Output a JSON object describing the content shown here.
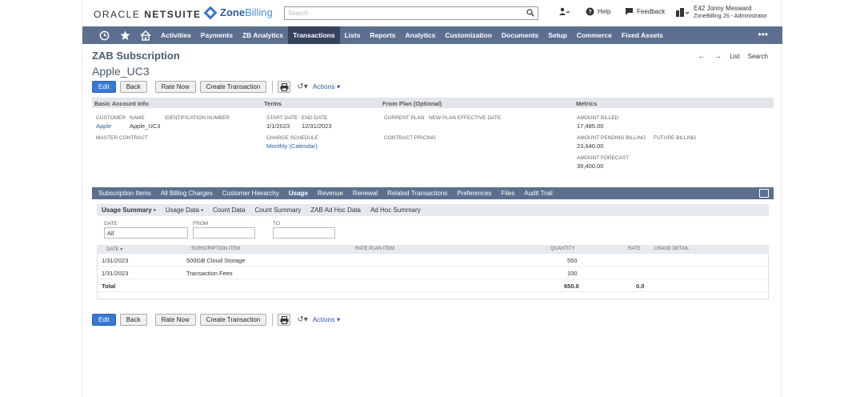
{
  "header": {
    "oracle_text": "ORACLE",
    "netsuite_text": "NETSUITE",
    "zb_bold": "Zone",
    "zb_light": "Billing",
    "search_placeholder": "Search",
    "help": "Help",
    "feedback": "Feedback",
    "user_name": "E42 Jonny Mesward",
    "user_role": "ZoneBilling JS - Administrator"
  },
  "nav": {
    "items": [
      "Activities",
      "Payments",
      "ZB Analytics",
      "Transactions",
      "Lists",
      "Reports",
      "Analytics",
      "Customization",
      "Documents",
      "Setup",
      "Commerce",
      "Fixed Assets"
    ],
    "active": "Transactions",
    "more": "•••"
  },
  "record": {
    "type": "ZAB Subscription",
    "name": "Apple_UC3",
    "list": "List",
    "search": "Search"
  },
  "buttons": {
    "edit": "Edit",
    "back": "Back",
    "rate_now": "Rate Now",
    "create_transaction": "Create Transaction",
    "actions": "Actions"
  },
  "sections": {
    "basic": "Basic Account Info",
    "terms": "Terms",
    "from_plan": "From Plan (Optional)",
    "metrics": "Metrics"
  },
  "fields": {
    "customer_label": "CUSTOMER",
    "customer_value": "Apple",
    "name_label": "NAME",
    "name_value": "Apple_UC3",
    "ident_label": "IDENTIFICATION NUMBER",
    "master_label": "MASTER CONTRACT",
    "start_label": "START DATE",
    "start_value": "1/1/2023",
    "end_label": "END DATE",
    "end_value": "12/31/2023",
    "charge_label": "CHARGE SCHEDULE",
    "charge_value": "Monthly (Calendar)",
    "current_plan_label": "CURRENT PLAN",
    "new_plan_label": "NEW PLAN EFFECTIVE DATE",
    "contract_pricing_label": "CONTRACT PRICING",
    "billed_label": "AMOUNT BILLED",
    "billed_value": "17,485.00",
    "pending_label": "AMOUNT PENDING BILLING",
    "future_label": "FUTURE BILLING",
    "pending_value": "23,640.00",
    "forecast_label": "AMOUNT FORECAST",
    "forecast_value": "39,400.00"
  },
  "subtabs": [
    "Subscription Items",
    "All Billing Charges",
    "Customer Hierarchy",
    "Usage",
    "Revenue",
    "Renewal",
    "Related Transactions",
    "Preferences",
    "Files",
    "Audit Trail"
  ],
  "subtab_active": "Usage",
  "usage_tabs": [
    "Usage Summary •",
    "Usage Data •",
    "Count Data",
    "Count Summary",
    "ZAB Ad Hoc Data",
    "Ad Hoc Summary"
  ],
  "filters": {
    "date_label": "DATE",
    "date_value": "All",
    "from_label": "FROM",
    "to_label": "TO"
  },
  "grid": {
    "headers": [
      "DATE ▾",
      "SUBSCRIPTION ITEM",
      "RATE PLAN ITEM",
      "QUANTITY",
      "RATE",
      "USAGE DETAIL"
    ],
    "rows": [
      {
        "date": "1/31/2023",
        "item": "500GB Cloud Storage",
        "qty": "550",
        "rate": ""
      },
      {
        "date": "1/31/2023",
        "item": "Transaction Fees",
        "qty": "100",
        "rate": ""
      }
    ],
    "total_label": "Total",
    "total_qty": "650.0",
    "total_rate": "0.0"
  }
}
